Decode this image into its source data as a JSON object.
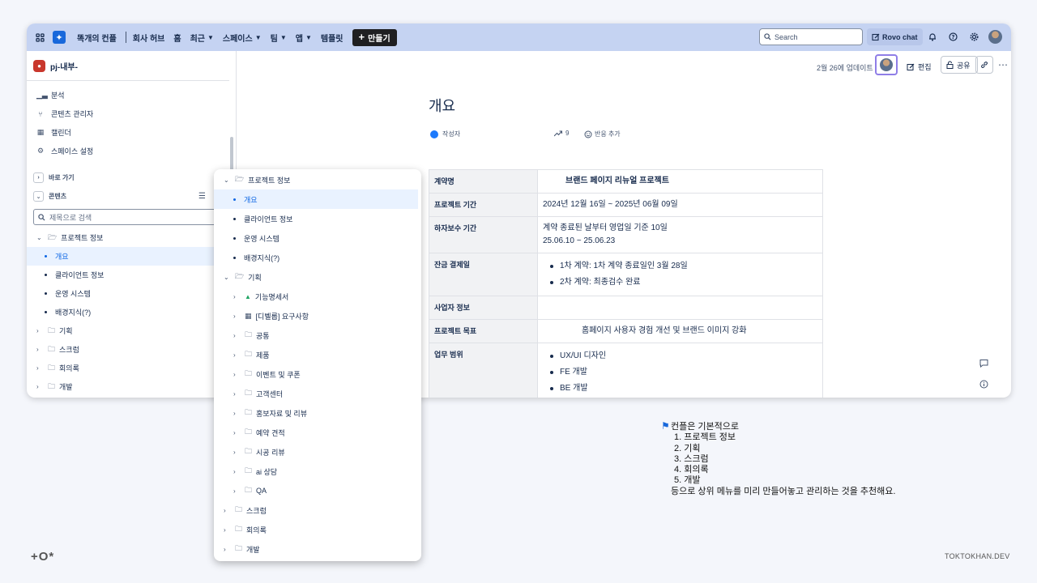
{
  "topbar": {
    "nav": [
      "똑개의 컨플",
      "회사 허브",
      "홈",
      "최근",
      "스페이스",
      "팀",
      "앱",
      "템플릿"
    ],
    "create_label": "만들기",
    "search_placeholder": "Search",
    "rovo_label": "Rovo chat"
  },
  "sidebar": {
    "space_name": "pj-내부-",
    "items": [
      {
        "icon": "analytics-icon",
        "label": "분석"
      },
      {
        "icon": "content-manager-icon",
        "label": "콘텐츠 관리자"
      },
      {
        "icon": "calendar-icon",
        "label": "캘린더"
      },
      {
        "icon": "gear-icon",
        "label": "스페이스 설정"
      }
    ],
    "shortcuts_label": "바로 가기",
    "content_label": "콘텐츠",
    "filter_placeholder": "제목으로 검색",
    "tree": [
      {
        "type": "folder-open",
        "label": "프로젝트 정보"
      },
      {
        "type": "page",
        "label": "개요",
        "active": true
      },
      {
        "type": "page",
        "label": "클라이언트 정보"
      },
      {
        "type": "page",
        "label": "운영 시스템"
      },
      {
        "type": "page",
        "label": "배경지식(?)"
      },
      {
        "type": "folder",
        "label": "기획"
      },
      {
        "type": "folder",
        "label": "스크럼"
      },
      {
        "type": "folder",
        "label": "회의록"
      },
      {
        "type": "folder",
        "label": "개발"
      }
    ]
  },
  "page": {
    "updated": "2월 26에 업데이트",
    "edit_label": "편집",
    "share_label": "공유",
    "title": "개요",
    "author": "작성자",
    "views": "9",
    "reaction": "반응 추가",
    "table": [
      {
        "key": "계약명",
        "value": "브랜드 페이지 리뉴얼 프로젝트"
      },
      {
        "key": "프로젝트 기간",
        "value": "2024년 12월 16일 ~ 2025년 06월 09일"
      },
      {
        "key": "하자보수 기간",
        "lines": [
          "계약 종료된 날부터 영업일 기준 10일",
          "25.06.10 ~ 25.06.23"
        ]
      },
      {
        "key": "잔금 결제일",
        "bullets": [
          "1차 계약: 1차 계약 종료일인 3월 28일",
          "2차 계약: 최종검수 완료"
        ]
      },
      {
        "key": "사업자 정보",
        "value": ""
      },
      {
        "key": "프로젝트 목표",
        "value": "홈페이지 사용자 경험 개선 및 브랜드 이미지 강화"
      },
      {
        "key": "업무 범위",
        "bullets": [
          "UX/UI 디자인",
          "FE 개발",
          "BE 개발"
        ]
      }
    ]
  },
  "popup_tree": [
    {
      "level": 0,
      "type": "folder-open",
      "label": "프로젝트 정보"
    },
    {
      "level": 1,
      "type": "page",
      "label": "개요",
      "active": true
    },
    {
      "level": 1,
      "type": "page",
      "label": "클라이언트 정보"
    },
    {
      "level": 1,
      "type": "page",
      "label": "운영 시스템"
    },
    {
      "level": 1,
      "type": "page",
      "label": "배경지식(?)"
    },
    {
      "level": 0,
      "type": "folder-open",
      "label": "기획"
    },
    {
      "level": 1,
      "type": "drive",
      "label": "기능명세서"
    },
    {
      "level": 1,
      "type": "table",
      "label": "[디벨롭] 요구사항"
    },
    {
      "level": 1,
      "type": "folder",
      "label": "공통"
    },
    {
      "level": 1,
      "type": "folder",
      "label": "제품"
    },
    {
      "level": 1,
      "type": "folder",
      "label": "이벤트 및 쿠폰"
    },
    {
      "level": 1,
      "type": "folder",
      "label": "고객센터"
    },
    {
      "level": 1,
      "type": "folder",
      "label": "홍보자료 및 리뷰"
    },
    {
      "level": 1,
      "type": "folder",
      "label": "예약 견적"
    },
    {
      "level": 1,
      "type": "folder",
      "label": "시공 리뷰"
    },
    {
      "level": 1,
      "type": "folder",
      "label": "ai 상담"
    },
    {
      "level": 1,
      "type": "folder",
      "label": "QA"
    },
    {
      "level": 0,
      "type": "folder",
      "label": "스크럼"
    },
    {
      "level": 0,
      "type": "folder",
      "label": "회의록"
    },
    {
      "level": 0,
      "type": "folder",
      "label": "개발"
    }
  ],
  "note": {
    "intro": "컨플은 기본적으로",
    "list": [
      "1. 프로젝트 정보",
      "2. 기획",
      "3. 스크럼",
      "4. 회의록",
      "5. 개발"
    ],
    "outro": "등으로 상위 메뉴를 미리 만들어놓고 관리하는 것을 추천해요."
  },
  "brand": {
    "mark": "+O*",
    "url": "TOKTOKHAN.DEV"
  },
  "colors": {
    "topbar": "#c5d3f2",
    "accent": "#0c66e4",
    "active_bg": "#e9f2ff"
  }
}
